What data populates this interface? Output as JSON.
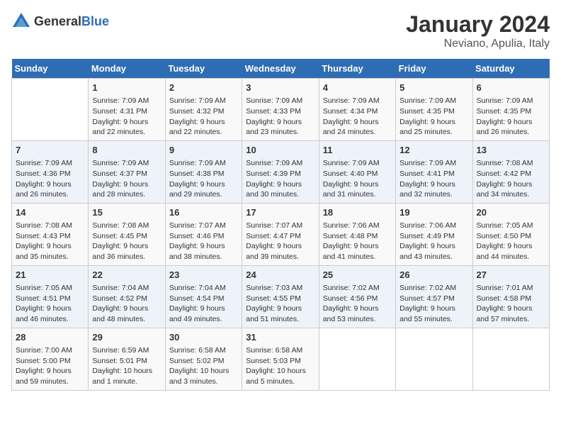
{
  "logo": {
    "general": "General",
    "blue": "Blue"
  },
  "title": "January 2024",
  "subtitle": "Neviano, Apulia, Italy",
  "weekdays": [
    "Sunday",
    "Monday",
    "Tuesday",
    "Wednesday",
    "Thursday",
    "Friday",
    "Saturday"
  ],
  "weeks": [
    [
      {
        "day": "",
        "info": ""
      },
      {
        "day": "1",
        "info": "Sunrise: 7:09 AM\nSunset: 4:31 PM\nDaylight: 9 hours\nand 22 minutes."
      },
      {
        "day": "2",
        "info": "Sunrise: 7:09 AM\nSunset: 4:32 PM\nDaylight: 9 hours\nand 22 minutes."
      },
      {
        "day": "3",
        "info": "Sunrise: 7:09 AM\nSunset: 4:33 PM\nDaylight: 9 hours\nand 23 minutes."
      },
      {
        "day": "4",
        "info": "Sunrise: 7:09 AM\nSunset: 4:34 PM\nDaylight: 9 hours\nand 24 minutes."
      },
      {
        "day": "5",
        "info": "Sunrise: 7:09 AM\nSunset: 4:35 PM\nDaylight: 9 hours\nand 25 minutes."
      },
      {
        "day": "6",
        "info": "Sunrise: 7:09 AM\nSunset: 4:35 PM\nDaylight: 9 hours\nand 26 minutes."
      }
    ],
    [
      {
        "day": "7",
        "info": "Sunrise: 7:09 AM\nSunset: 4:36 PM\nDaylight: 9 hours\nand 26 minutes."
      },
      {
        "day": "8",
        "info": "Sunrise: 7:09 AM\nSunset: 4:37 PM\nDaylight: 9 hours\nand 28 minutes."
      },
      {
        "day": "9",
        "info": "Sunrise: 7:09 AM\nSunset: 4:38 PM\nDaylight: 9 hours\nand 29 minutes."
      },
      {
        "day": "10",
        "info": "Sunrise: 7:09 AM\nSunset: 4:39 PM\nDaylight: 9 hours\nand 30 minutes."
      },
      {
        "day": "11",
        "info": "Sunrise: 7:09 AM\nSunset: 4:40 PM\nDaylight: 9 hours\nand 31 minutes."
      },
      {
        "day": "12",
        "info": "Sunrise: 7:09 AM\nSunset: 4:41 PM\nDaylight: 9 hours\nand 32 minutes."
      },
      {
        "day": "13",
        "info": "Sunrise: 7:08 AM\nSunset: 4:42 PM\nDaylight: 9 hours\nand 34 minutes."
      }
    ],
    [
      {
        "day": "14",
        "info": "Sunrise: 7:08 AM\nSunset: 4:43 PM\nDaylight: 9 hours\nand 35 minutes."
      },
      {
        "day": "15",
        "info": "Sunrise: 7:08 AM\nSunset: 4:45 PM\nDaylight: 9 hours\nand 36 minutes."
      },
      {
        "day": "16",
        "info": "Sunrise: 7:07 AM\nSunset: 4:46 PM\nDaylight: 9 hours\nand 38 minutes."
      },
      {
        "day": "17",
        "info": "Sunrise: 7:07 AM\nSunset: 4:47 PM\nDaylight: 9 hours\nand 39 minutes."
      },
      {
        "day": "18",
        "info": "Sunrise: 7:06 AM\nSunset: 4:48 PM\nDaylight: 9 hours\nand 41 minutes."
      },
      {
        "day": "19",
        "info": "Sunrise: 7:06 AM\nSunset: 4:49 PM\nDaylight: 9 hours\nand 43 minutes."
      },
      {
        "day": "20",
        "info": "Sunrise: 7:05 AM\nSunset: 4:50 PM\nDaylight: 9 hours\nand 44 minutes."
      }
    ],
    [
      {
        "day": "21",
        "info": "Sunrise: 7:05 AM\nSunset: 4:51 PM\nDaylight: 9 hours\nand 46 minutes."
      },
      {
        "day": "22",
        "info": "Sunrise: 7:04 AM\nSunset: 4:52 PM\nDaylight: 9 hours\nand 48 minutes."
      },
      {
        "day": "23",
        "info": "Sunrise: 7:04 AM\nSunset: 4:54 PM\nDaylight: 9 hours\nand 49 minutes."
      },
      {
        "day": "24",
        "info": "Sunrise: 7:03 AM\nSunset: 4:55 PM\nDaylight: 9 hours\nand 51 minutes."
      },
      {
        "day": "25",
        "info": "Sunrise: 7:02 AM\nSunset: 4:56 PM\nDaylight: 9 hours\nand 53 minutes."
      },
      {
        "day": "26",
        "info": "Sunrise: 7:02 AM\nSunset: 4:57 PM\nDaylight: 9 hours\nand 55 minutes."
      },
      {
        "day": "27",
        "info": "Sunrise: 7:01 AM\nSunset: 4:58 PM\nDaylight: 9 hours\nand 57 minutes."
      }
    ],
    [
      {
        "day": "28",
        "info": "Sunrise: 7:00 AM\nSunset: 5:00 PM\nDaylight: 9 hours\nand 59 minutes."
      },
      {
        "day": "29",
        "info": "Sunrise: 6:59 AM\nSunset: 5:01 PM\nDaylight: 10 hours\nand 1 minute."
      },
      {
        "day": "30",
        "info": "Sunrise: 6:58 AM\nSunset: 5:02 PM\nDaylight: 10 hours\nand 3 minutes."
      },
      {
        "day": "31",
        "info": "Sunrise: 6:58 AM\nSunset: 5:03 PM\nDaylight: 10 hours\nand 5 minutes."
      },
      {
        "day": "",
        "info": ""
      },
      {
        "day": "",
        "info": ""
      },
      {
        "day": "",
        "info": ""
      }
    ]
  ]
}
